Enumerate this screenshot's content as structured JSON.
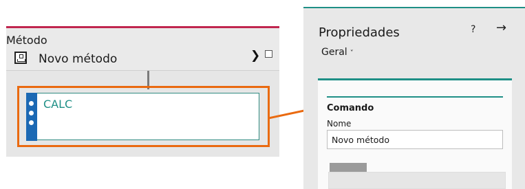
{
  "method": {
    "type_label": "Método",
    "name": "Novo método",
    "step_label": "CALC"
  },
  "panel": {
    "title": "Propriedades",
    "help": "?",
    "close": "→",
    "tab": "Geral",
    "tab_chevron": "˅",
    "group_title": "Comando",
    "name_label": "Nome",
    "name_value": "Novo método"
  },
  "colors": {
    "accent_red": "#c0264f",
    "highlight_orange": "#ea6a10",
    "teal": "#1e8f86",
    "handle_blue": "#1c69b4"
  },
  "icons": [
    "method-icon",
    "chevron-right-icon",
    "checkbox",
    "drag-handle-icon",
    "help-icon",
    "close-arrow-icon"
  ]
}
